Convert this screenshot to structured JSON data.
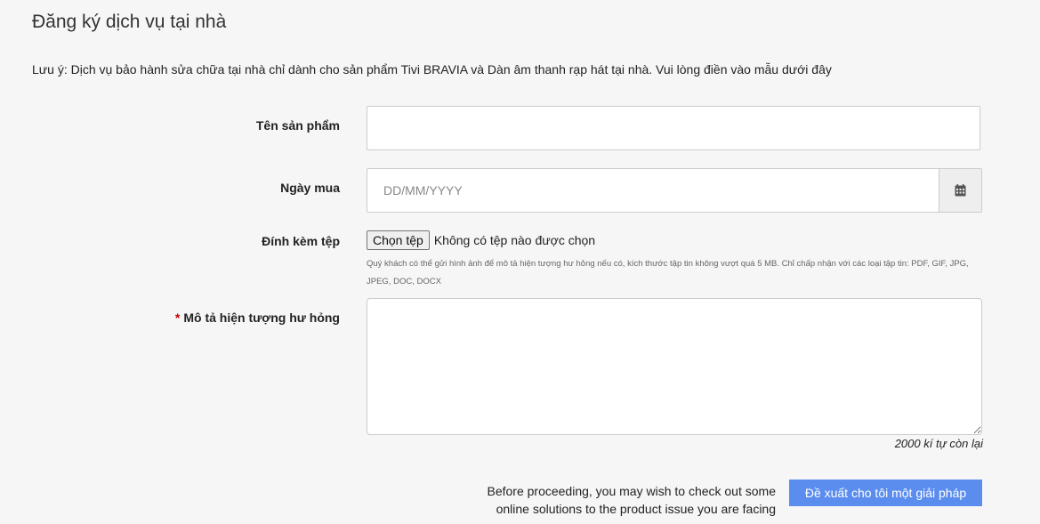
{
  "page": {
    "title": "Đăng ký dịch vụ tại nhà",
    "note": "Lưu ý: Dịch vụ bảo hành sửa chữa tại nhà chỉ dành cho sản phẩm Tivi BRAVIA và Dàn âm thanh rạp hát tại nhà. Vui lòng điền vào mẫu dưới đây"
  },
  "form": {
    "product_name": {
      "label": "Tên sản phẩm",
      "value": ""
    },
    "purchase_date": {
      "label": "Ngày mua",
      "placeholder": "DD/MM/YYYY",
      "icon": "calendar-icon"
    },
    "attachment": {
      "label": "Đính kèm tệp",
      "button_label": "Chọn tệp",
      "status": "Không có tệp nào được chọn",
      "hint": "Quý khách có thể gửi hình ảnh để mô tả hiện tượng hư hỏng nếu có, kích thước tập tin không vượt quá 5 MB. Chỉ chấp nhận với các loại tập tin: PDF, GIF, JPG, JPEG, DOC, DOCX"
    },
    "description": {
      "required_mark": "*",
      "label": "Mô tả hiện tượng hư hỏng",
      "value": "",
      "char_count": "2000 kí tự còn lại"
    }
  },
  "footer": {
    "proceed_text_line1": "Before proceeding, you may wish to check out some",
    "proceed_text_line2": "online solutions to the product issue you are facing",
    "suggest_button": "Đề xuất cho tôi một giải pháp"
  },
  "colors": {
    "background": "#f6f6f6",
    "button_primary": "#5b8def",
    "required": "#cc0000"
  }
}
